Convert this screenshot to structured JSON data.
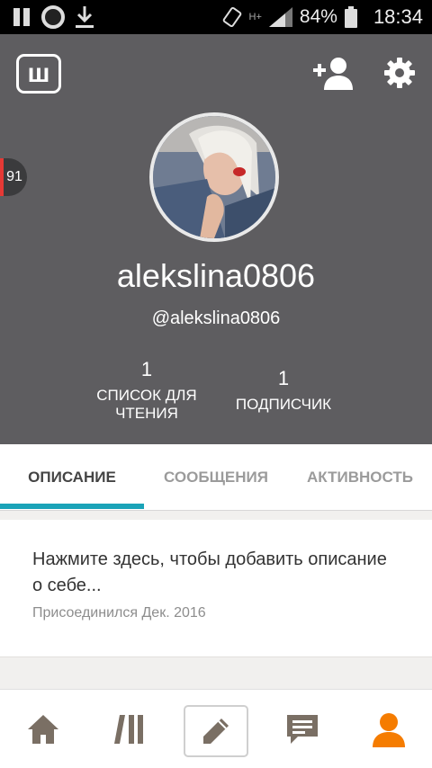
{
  "status_bar": {
    "battery": "84%",
    "time": "18:34",
    "network": "H+"
  },
  "header": {
    "logo_letter": "ш",
    "notification_count": "91",
    "username": "alekslina0806",
    "handle": "@alekslina0806",
    "stats": [
      {
        "value": "1",
        "label": "СПИСОК ДЛЯ ЧТЕНИЯ"
      },
      {
        "value": "1",
        "label": "ПОДПИСЧИК"
      }
    ]
  },
  "tabs": [
    {
      "label": "ОПИСАНИЕ",
      "active": true
    },
    {
      "label": "СООБЩЕНИЯ",
      "active": false
    },
    {
      "label": "АКТИВНОСТЬ",
      "active": false
    }
  ],
  "about": {
    "prompt": "Нажмите здесь, чтобы добавить описание о себе...",
    "joined": "Присоединился Дек. 2016"
  },
  "bottom_nav": [
    {
      "icon": "home-icon"
    },
    {
      "icon": "library-icon"
    },
    {
      "icon": "pencil-icon"
    },
    {
      "icon": "messages-icon"
    },
    {
      "icon": "profile-icon",
      "active": true
    }
  ],
  "colors": {
    "header_bg": "#5e5d60",
    "accent": "#1aa3b8",
    "active_nav": "#f57c00",
    "inactive_nav": "#7a6f64"
  }
}
